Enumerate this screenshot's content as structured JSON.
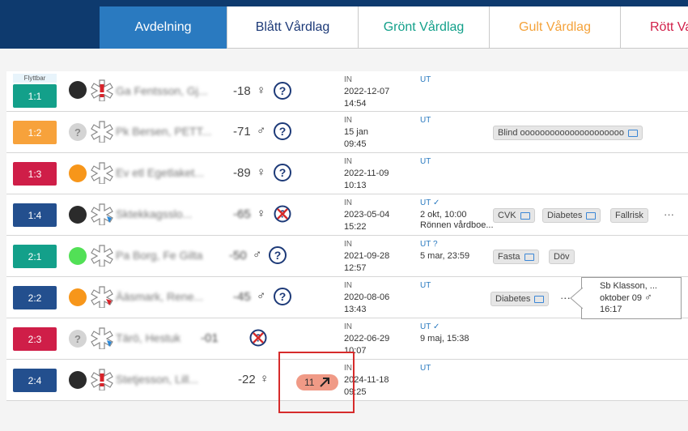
{
  "tabs": [
    {
      "label": "Avdelning",
      "color": "#ffffff"
    },
    {
      "label": "Blått Vårdlag",
      "color": "#1d3a78"
    },
    {
      "label": "Grönt Vårdlag",
      "color": "#12a08a"
    },
    {
      "label": "Gult Vårdlag",
      "color": "#f4a23a"
    },
    {
      "label": "Rött Va",
      "color": "#d1204a"
    }
  ],
  "flyttbar_label": "Flyttbar",
  "in_label": "IN",
  "ut_label": "UT",
  "rows": [
    {
      "room": "1:1",
      "room_color": "#13a08a",
      "name": "Ga Fentsson, Gj...",
      "age": "-18",
      "sex": "♀",
      "in_date": "2022-12-07",
      "in_time": "14:54",
      "ut_mark": "",
      "ut_line1": "",
      "ut_line2": ""
    },
    {
      "room": "1:2",
      "room_color": "#f7a23b",
      "name": "Pk Bersen, PETT...",
      "age": "-71",
      "sex": "♂",
      "in_date": "15 jan",
      "in_time": "09:45",
      "ut_mark": "",
      "ut_line1": "",
      "ut_line2": "",
      "chips": [
        "Blind ooooooooooooooooooooo"
      ]
    },
    {
      "room": "1:3",
      "room_color": "#cf1e48",
      "name": "Ev etl Egetlaket...",
      "age": "-89",
      "sex": "♀",
      "in_date": "2022-11-09",
      "in_time": "10:13",
      "ut_mark": "",
      "ut_line1": "",
      "ut_line2": ""
    },
    {
      "room": "1:4",
      "room_color": "#234f8e",
      "name": "Sktekkagsslo...",
      "age": "-65",
      "sex": "♀",
      "in_date": "2023-05-04",
      "in_time": "15:22",
      "ut_mark": "✓",
      "ut_line1": "2 okt, 10:00",
      "ut_line2": "Rönnen vårdboe...",
      "chips": [
        "CVK",
        "Diabetes",
        "Fallrisk"
      ]
    },
    {
      "room": "2:1",
      "room_color": "#13a08a",
      "name": "Pa Borg, Fe Gilta",
      "age": "-50",
      "sex": "♂",
      "in_date": "2021-09-28",
      "in_time": "12:57",
      "ut_mark": "?",
      "ut_line1": "5 mar, 23:59",
      "ut_line2": "",
      "chips": [
        "Fasta",
        "Döv"
      ]
    },
    {
      "room": "2:2",
      "room_color": "#234f8e",
      "name": "Ääsmark, Rene...",
      "age": "-45",
      "sex": "♂",
      "in_date": "2020-08-06",
      "in_time": "13:43",
      "ut_mark": "",
      "ut_line1": "",
      "ut_line2": "",
      "chips": [
        "Diabetes"
      ]
    },
    {
      "room": "2:3",
      "room_color": "#cf1e48",
      "name": "Tärö, Hestuk",
      "age": "-01",
      "sex": "",
      "in_date": "2022-06-29",
      "in_time": "10:07",
      "ut_mark": "✓",
      "ut_line1": "9 maj, 15:38",
      "ut_line2": ""
    },
    {
      "room": "2:4",
      "room_color": "#234f8e",
      "name": "Stetjesson, Lill...",
      "age": "-22",
      "sex": "♀",
      "in_date": "2024-11-18",
      "in_time": "09:25",
      "ut_mark": "",
      "ut_line1": "",
      "ut_line2": "",
      "badge": "11"
    }
  ],
  "callout": {
    "line1": "Sb Klasson, ...",
    "line2": "oktober 09",
    "sex": "♂",
    "line3": "16:17"
  },
  "ellipsis": "···"
}
